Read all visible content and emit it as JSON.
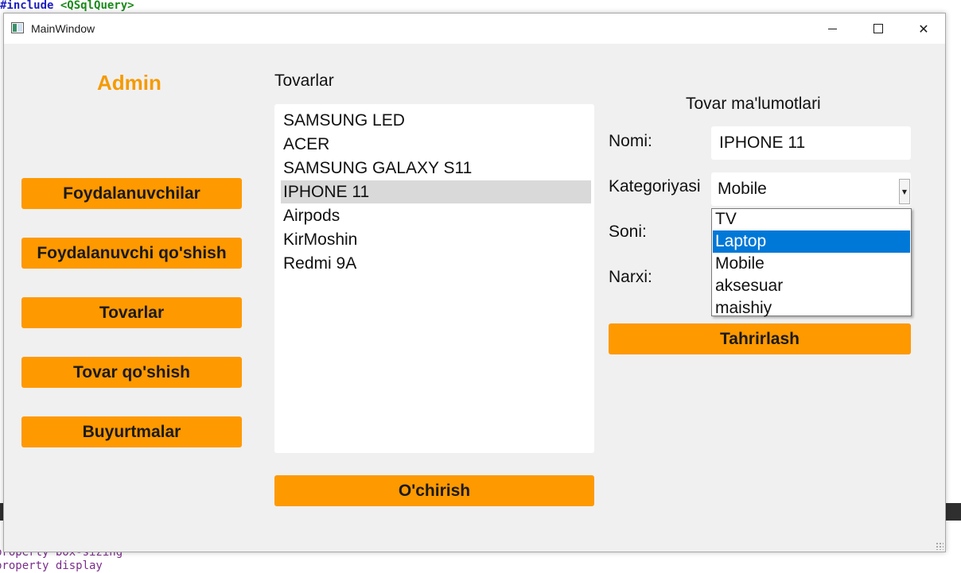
{
  "background_editor": {
    "top_line_keyword": "#include",
    "top_line_header": "<QSqlQuery>",
    "bottom_line_1": "property box-sizing",
    "bottom_line_2": "property display"
  },
  "window": {
    "title": "MainWindow",
    "controls": {
      "minimize": "—",
      "maximize": "☐",
      "close": "✕"
    }
  },
  "sidebar": {
    "role_label": "Admin",
    "buttons": [
      "Foydalanuvchilar",
      "Foydalanuvchi qo'shish",
      "Tovarlar",
      "Tovar qo'shish",
      "Buyurtmalar"
    ]
  },
  "products": {
    "section_title": "Tovarlar",
    "items": [
      "SAMSUNG LED",
      "ACER",
      "SAMSUNG GALAXY S11",
      "IPHONE 11",
      "Airpods",
      "KirMoshin",
      "Redmi 9A"
    ],
    "selected_index": 3,
    "delete_label": "O'chirish"
  },
  "details": {
    "section_title": "Tovar ma'lumotlari",
    "name_label": "Nomi:",
    "name_value": "IPHONE 11",
    "category_label": "Kategoriyasi",
    "category_value": "Mobile",
    "count_label": "Soni:",
    "price_label": "Narxi:",
    "category_options": [
      "TV",
      "Laptop",
      "Mobile",
      "aksesuar",
      "maishiy"
    ],
    "highlighted_option_index": 1,
    "edit_label": "Tahrirlash"
  },
  "colors": {
    "accent": "#ff9900",
    "admin_text": "#f59a00",
    "selection_highlight": "#0078d7",
    "list_selection": "#d9d9d9"
  }
}
